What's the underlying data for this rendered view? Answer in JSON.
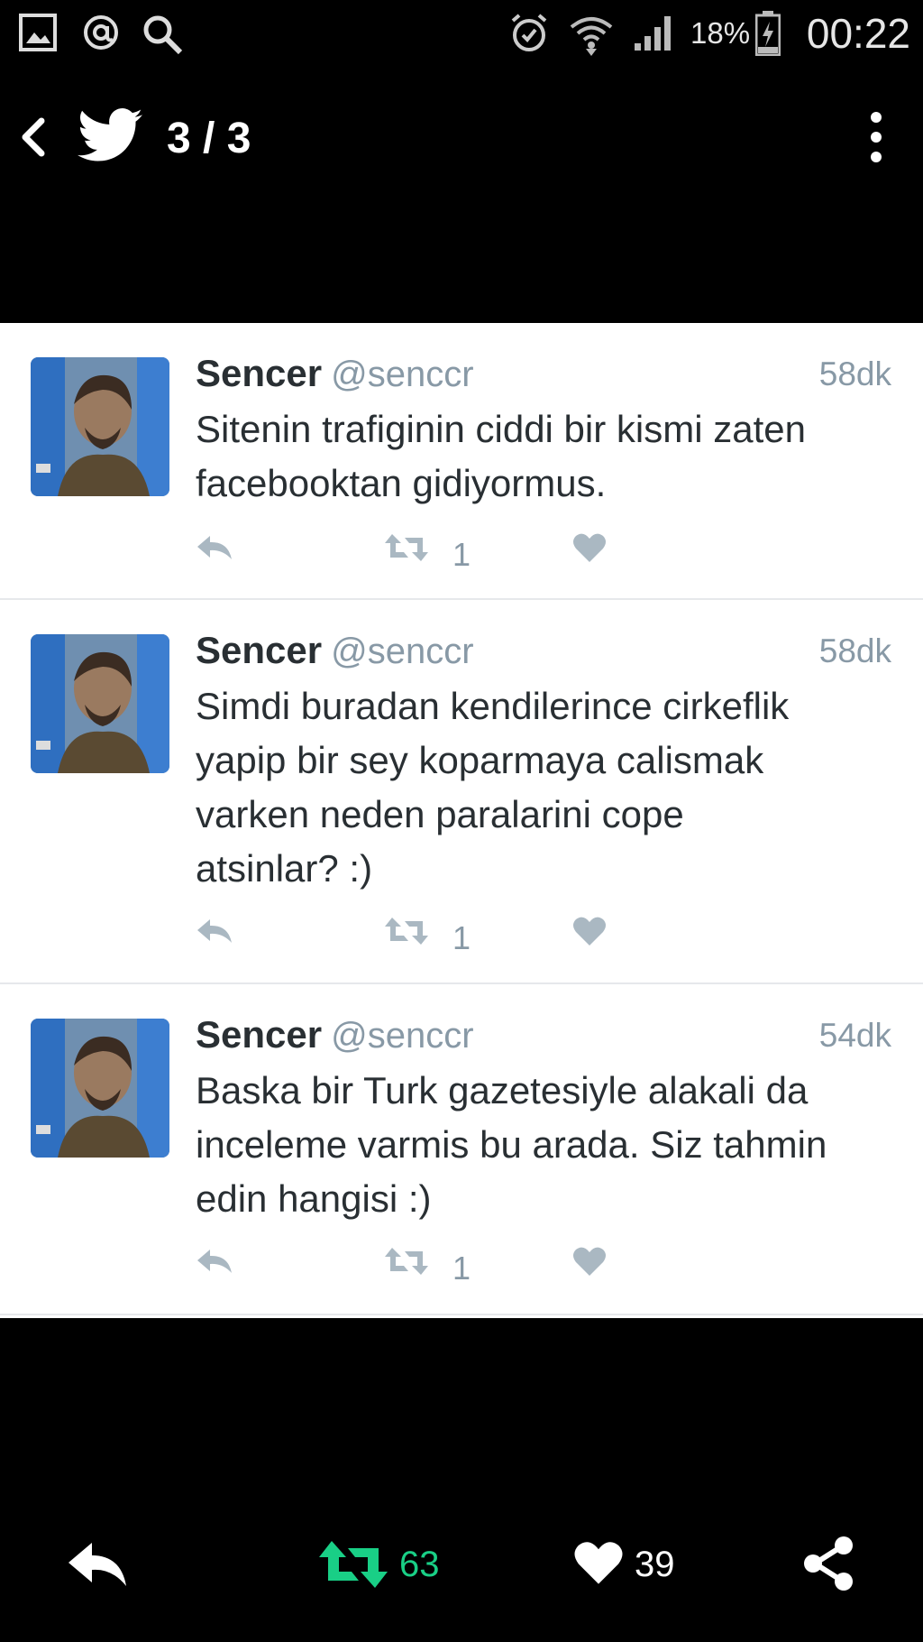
{
  "status_bar": {
    "left_icons": [
      "gallery-icon",
      "at-icon",
      "search-icon"
    ],
    "right_icons": [
      "alarm-icon",
      "wifi-icon",
      "signal-icon",
      "battery-icon"
    ],
    "battery": "18%",
    "time": "00:22"
  },
  "toolbar": {
    "back_icon": "chevron-left-icon",
    "logo_icon": "twitter-bird-icon",
    "counter": "3 / 3",
    "menu_icon": "overflow-menu-icon"
  },
  "tweets": [
    {
      "name": "Sencer",
      "handle": "@senccr",
      "time": "58dk",
      "lines": [
        "Sitenin trafiginin ciddi bir kismi zaten",
        "facebooktan gidiyormus."
      ],
      "retweets": "1"
    },
    {
      "name": "Sencer",
      "handle": "@senccr",
      "time": "58dk",
      "lines": [
        "Simdi buradan kendilerince cirkeflik",
        "yapip bir sey koparmaya calismak",
        "varken neden paralarini cope",
        "atsinlar? :)"
      ],
      "retweets": "1"
    },
    {
      "name": "Sencer",
      "handle": "@senccr",
      "time": "54dk",
      "lines": [
        "Baska bir Turk gazetesiyle alakali da",
        "inceleme varmis bu arada. Siz tahmin",
        "edin hangisi :)"
      ],
      "retweets": "1"
    }
  ],
  "bottom_bar": {
    "reply_icon": "reply-icon",
    "retweet_icon": "retweet-icon",
    "retweet_count": "63",
    "like_icon": "heart-icon",
    "like_count": "39",
    "share_icon": "share-icon"
  },
  "colors": {
    "background": "#000000",
    "card": "#ffffff",
    "text": "#292f33",
    "muted": "#8899a6",
    "retweet_green": "#19cf86"
  }
}
